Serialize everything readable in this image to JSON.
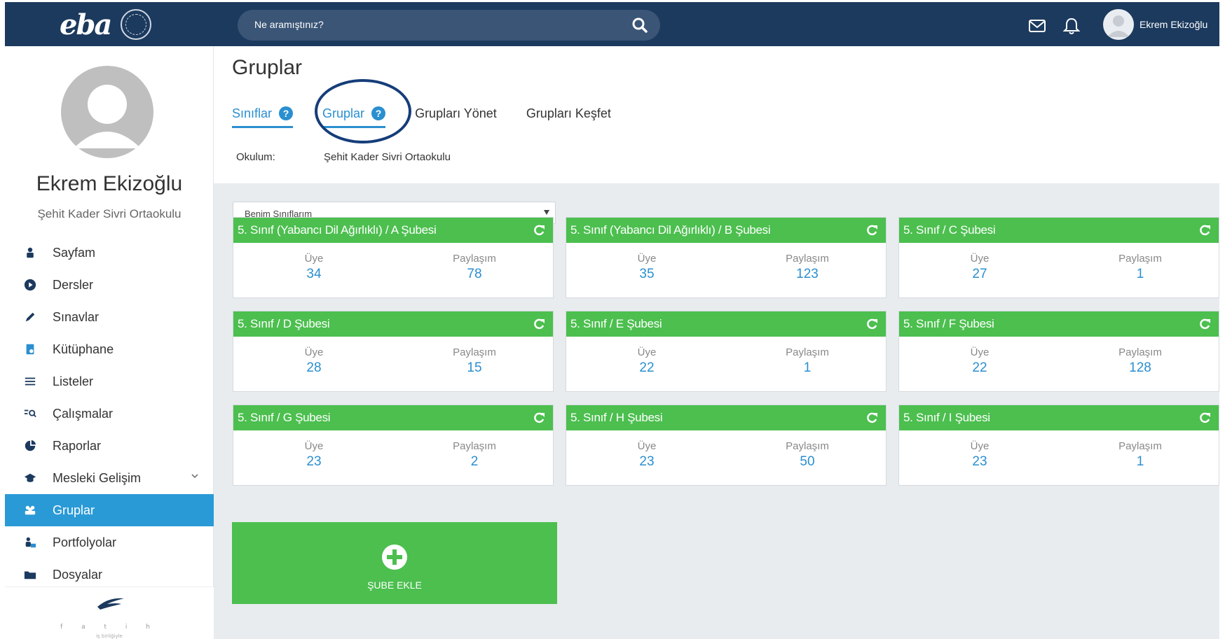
{
  "topbar": {
    "logo_text": "eba",
    "search_placeholder": "Ne aramıştınız?",
    "user_name": "Ekrem Ekizoğlu",
    "icons": [
      "search-icon",
      "mail-icon",
      "bell-icon",
      "user-avatar-icon"
    ]
  },
  "sidebar": {
    "profile_name": "Ekrem Ekizoğlu",
    "profile_school": "Şehit Kader Sivri Ortaokulu",
    "items": [
      {
        "label": "Sayfam",
        "icon": "person-icon"
      },
      {
        "label": "Dersler",
        "icon": "play-circle-icon"
      },
      {
        "label": "Sınavlar",
        "icon": "pencil-icon"
      },
      {
        "label": "Kütüphane",
        "icon": "library-icon"
      },
      {
        "label": "Listeler",
        "icon": "list-icon"
      },
      {
        "label": "Çalışmalar",
        "icon": "search-list-icon"
      },
      {
        "label": "Raporlar",
        "icon": "pie-chart-icon"
      },
      {
        "label": "Mesleki Gelişim",
        "icon": "graduation-cap-icon"
      },
      {
        "label": "Gruplar",
        "icon": "group-icon"
      },
      {
        "label": "Portfolyolar",
        "icon": "portfolio-icon"
      },
      {
        "label": "Dosyalar",
        "icon": "folder-icon"
      }
    ],
    "active_item": "Gruplar",
    "footer_logo_text": "f a t i h",
    "footer_sub": "iş birliğiyle"
  },
  "main": {
    "title": "Gruplar",
    "tabs": [
      {
        "label": "Sınıflar",
        "help": "?"
      },
      {
        "label": "Gruplar",
        "help": "?"
      },
      {
        "label": "Grupları Yönet"
      },
      {
        "label": "Grupları Keşfet"
      }
    ],
    "active_tab": "Gruplar",
    "school_label": "Okulum:",
    "school_value": "Şehit Kader Sivri Ortaokulu",
    "select_value": "Benim Sınıflarım",
    "stat_labels": {
      "members": "Üye",
      "shares": "Paylaşım"
    },
    "groups": [
      {
        "title": "5. Sınıf (Yabancı Dil Ağırlıklı) / A Şubesi",
        "members": "34",
        "shares": "78"
      },
      {
        "title": "5. Sınıf (Yabancı Dil Ağırlıklı) / B Şubesi",
        "members": "35",
        "shares": "123"
      },
      {
        "title": "5. Sınıf / C Şubesi",
        "members": "27",
        "shares": "1"
      },
      {
        "title": "5. Sınıf / D Şubesi",
        "members": "28",
        "shares": "15"
      },
      {
        "title": "5. Sınıf / E Şubesi",
        "members": "22",
        "shares": "1"
      },
      {
        "title": "5. Sınıf / F Şubesi",
        "members": "22",
        "shares": "128"
      },
      {
        "title": "5. Sınıf / G Şubesi",
        "members": "23",
        "shares": "2"
      },
      {
        "title": "5. Sınıf / H Şubesi",
        "members": "23",
        "shares": "50"
      },
      {
        "title": "5. Sınıf / I Şubesi",
        "members": "23",
        "shares": "1"
      }
    ],
    "add_label": "ŞUBE EKLE"
  },
  "colors": {
    "topbar": "#1c3a5e",
    "accent": "#2a8fd0",
    "card_green": "#4cbf4f",
    "content_bg": "#e8ecef",
    "highlight_ring": "#163d7a"
  }
}
